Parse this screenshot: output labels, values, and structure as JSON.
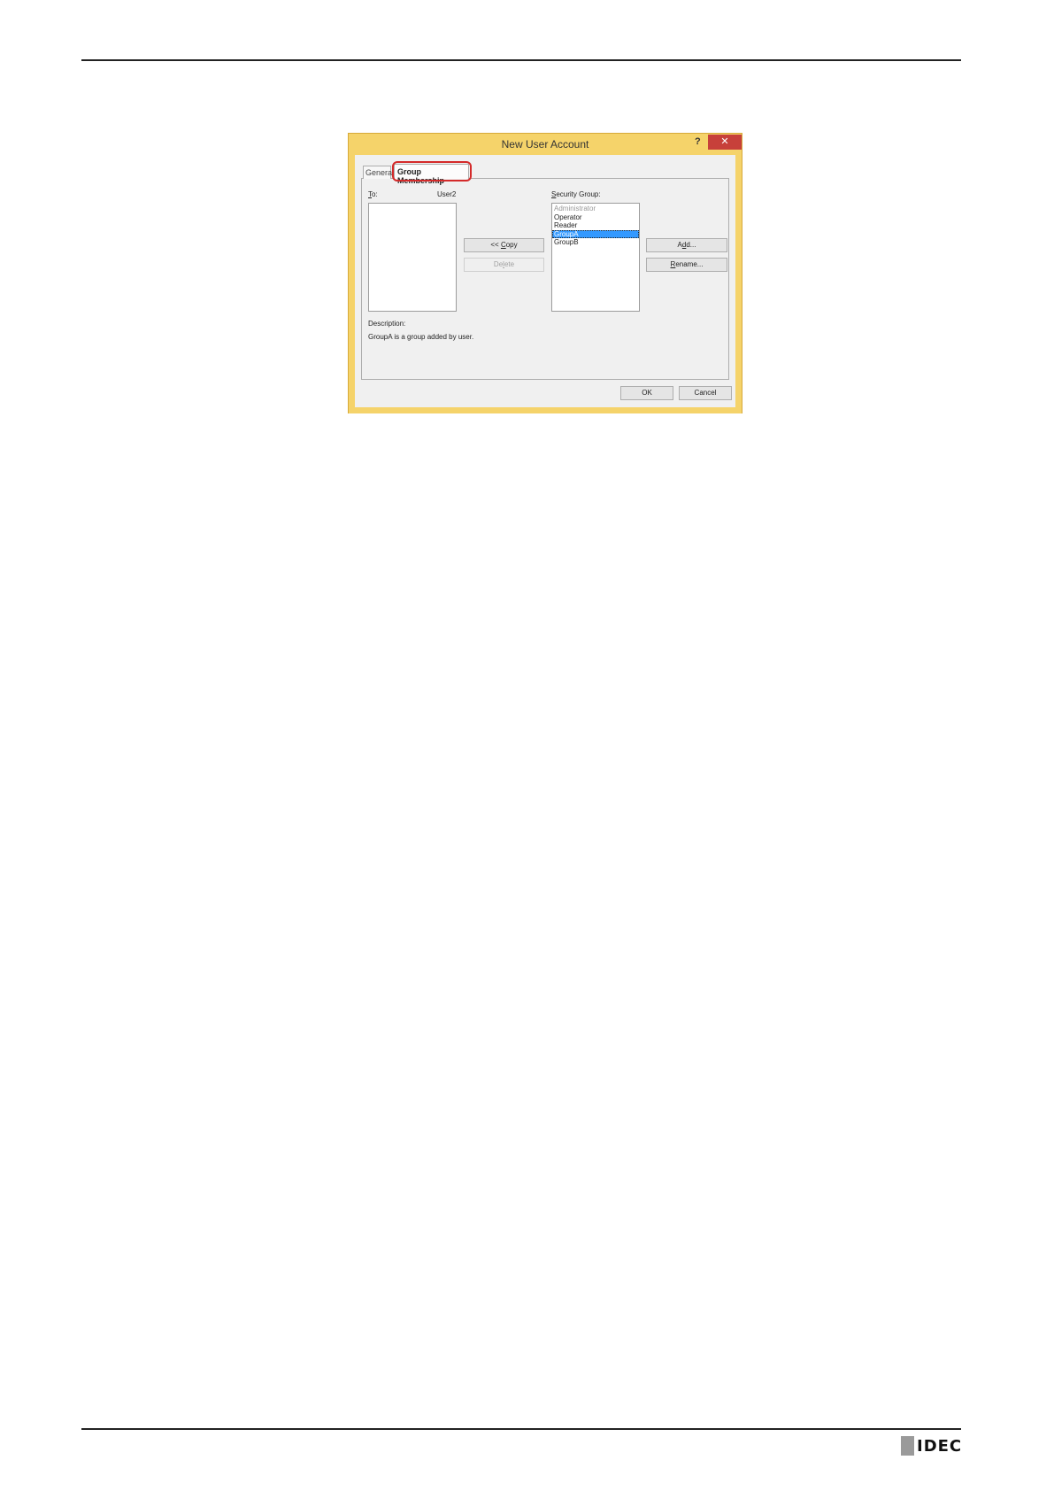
{
  "dialog": {
    "title": "New User Account",
    "help_glyph": "?",
    "close_glyph": "✕",
    "tabs": [
      {
        "label": "General"
      },
      {
        "label": "Group Membership"
      }
    ],
    "to": {
      "label_first": "T",
      "label_rest": "o:",
      "user": "User2",
      "items": []
    },
    "buttons": {
      "copy": {
        "pre": "<< ",
        "key": "C",
        "post": "opy"
      },
      "delete": {
        "pre": "De",
        "key": "l",
        "post": "ete"
      },
      "add": {
        "pre": "A",
        "key": "d",
        "post": "d..."
      },
      "rename": {
        "pre": "",
        "key": "R",
        "post": "ename..."
      },
      "ok": "OK",
      "cancel": "Cancel"
    },
    "security_group": {
      "label_first": "S",
      "label_rest": "ecurity Group:",
      "items": [
        "Administrator",
        "Operator",
        "Reader",
        "GroupA",
        "GroupB"
      ],
      "selected": "GroupA"
    },
    "description": {
      "label": "Description:",
      "text": "GroupA is a group added by user."
    }
  },
  "footer": {
    "logo_text": "IDEC"
  }
}
